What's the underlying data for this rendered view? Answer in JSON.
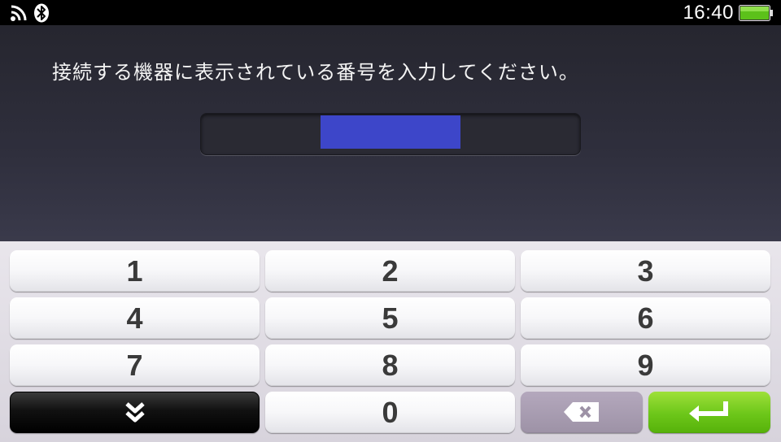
{
  "status_bar": {
    "time": "16:40",
    "icons": [
      "wifi-signal-icon",
      "bluetooth-icon",
      "battery-icon"
    ],
    "battery_color": "#5cc11a"
  },
  "prompt": {
    "instruction": "接続する機器に表示されている番号を入力してください。",
    "code_value": "",
    "highlight_color": "#3d46c9"
  },
  "keypad": {
    "keys": [
      "1",
      "2",
      "3",
      "4",
      "5",
      "6",
      "7",
      "8",
      "9",
      "0"
    ],
    "hide_icon": "double-chevron-down-icon",
    "backspace_icon": "backspace-icon",
    "enter_icon": "enter-icon",
    "enter_color": "#6cc619"
  }
}
